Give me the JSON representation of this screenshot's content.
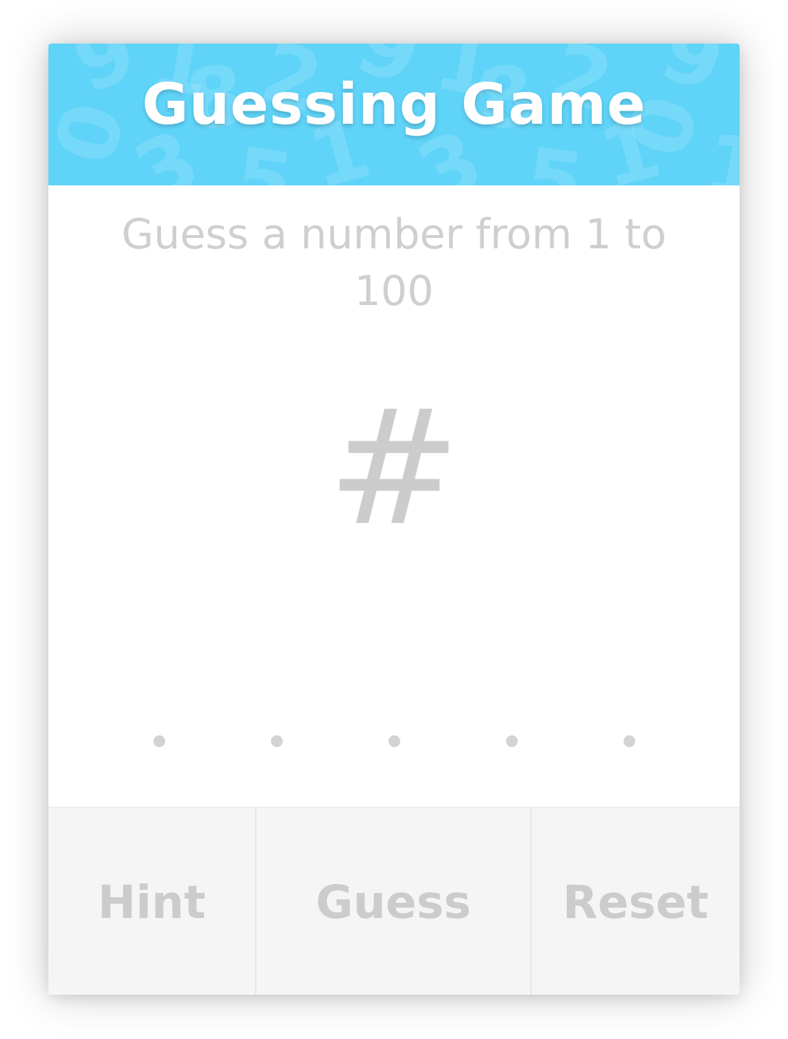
{
  "header": {
    "title": "Guessing Game",
    "background_color": "#5fd3f8"
  },
  "prompt": "Guess a number from 1 to 100",
  "guess_display": "#",
  "attempts": {
    "total": 5,
    "used": 0
  },
  "buttons": {
    "hint": "Hint",
    "guess": "Guess",
    "reset": "Reset"
  }
}
